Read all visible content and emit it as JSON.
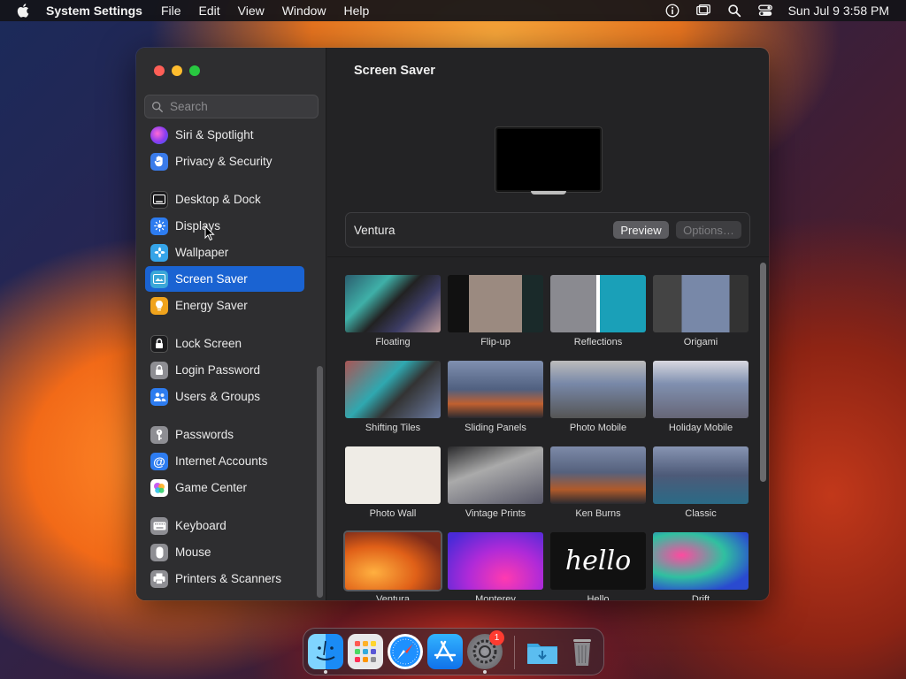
{
  "menubar": {
    "app_name": "System Settings",
    "menus": [
      "File",
      "Edit",
      "View",
      "Window",
      "Help"
    ],
    "clock": "Sun Jul 9  3:58 PM"
  },
  "sidebar": {
    "search_placeholder": "Search",
    "items": [
      {
        "label": "Siri & Spotlight",
        "icon": "siri-icon",
        "color": "#a040e0"
      },
      {
        "label": "Privacy & Security",
        "icon": "hand-icon",
        "color": "#3a7bea"
      },
      {
        "label": "Desktop & Dock",
        "icon": "desktop-dock-icon",
        "color": "#1c1c1e"
      },
      {
        "label": "Displays",
        "icon": "displays-icon",
        "color": "#2d7cf0"
      },
      {
        "label": "Wallpaper",
        "icon": "wallpaper-icon",
        "color": "#35a4e8"
      },
      {
        "label": "Screen Saver",
        "icon": "screen-saver-icon",
        "color": "#3aa7d8",
        "selected": true
      },
      {
        "label": "Energy Saver",
        "icon": "bulb-icon",
        "color": "#f0a31c"
      },
      {
        "label": "Lock Screen",
        "icon": "lock-icon",
        "color": "#1c1c1e"
      },
      {
        "label": "Login Password",
        "icon": "login-lock-icon",
        "color": "#8e8e93"
      },
      {
        "label": "Users & Groups",
        "icon": "users-icon",
        "color": "#2d7cf0"
      },
      {
        "label": "Passwords",
        "icon": "key-icon",
        "color": "#8e8e93"
      },
      {
        "label": "Internet Accounts",
        "icon": "at-icon",
        "color": "#2d7cf0"
      },
      {
        "label": "Game Center",
        "icon": "game-center-icon",
        "color": "#ffffff"
      },
      {
        "label": "Keyboard",
        "icon": "keyboard-icon",
        "color": "#8e8e93"
      },
      {
        "label": "Mouse",
        "icon": "mouse-icon",
        "color": "#8e8e93"
      },
      {
        "label": "Printers & Scanners",
        "icon": "printer-icon",
        "color": "#8e8e93"
      }
    ]
  },
  "content": {
    "title": "Screen Saver",
    "current_saver": "Ventura",
    "preview_label": "Preview",
    "options_label": "Options…",
    "savers": [
      {
        "label": "Floating",
        "style": "floating"
      },
      {
        "label": "Flip-up",
        "style": "flipup"
      },
      {
        "label": "Reflections",
        "style": "reflections"
      },
      {
        "label": "Origami",
        "style": "origami"
      },
      {
        "label": "Shifting Tiles",
        "style": "shifting"
      },
      {
        "label": "Sliding Panels",
        "style": "sliding"
      },
      {
        "label": "Photo Mobile",
        "style": "photomobile"
      },
      {
        "label": "Holiday Mobile",
        "style": "holiday"
      },
      {
        "label": "Photo Wall",
        "style": "photowall"
      },
      {
        "label": "Vintage Prints",
        "style": "vintage"
      },
      {
        "label": "Ken Burns",
        "style": "kenburns"
      },
      {
        "label": "Classic",
        "style": "classic"
      },
      {
        "label": "Ventura",
        "style": "ventura",
        "selected": true
      },
      {
        "label": "Monterey",
        "style": "monterey"
      },
      {
        "label": "Hello",
        "style": "hello"
      },
      {
        "label": "Drift",
        "style": "drift"
      }
    ],
    "hello_text": "hello"
  },
  "dock": {
    "apps": [
      {
        "name": "finder-icon",
        "running": true
      },
      {
        "name": "launchpad-icon",
        "running": false
      },
      {
        "name": "safari-icon",
        "running": false
      },
      {
        "name": "app-store-icon",
        "running": false
      },
      {
        "name": "system-settings-icon",
        "running": true,
        "badge": "1"
      },
      {
        "name": "downloads-folder-icon",
        "running": false
      },
      {
        "name": "trash-icon",
        "running": false
      }
    ]
  }
}
